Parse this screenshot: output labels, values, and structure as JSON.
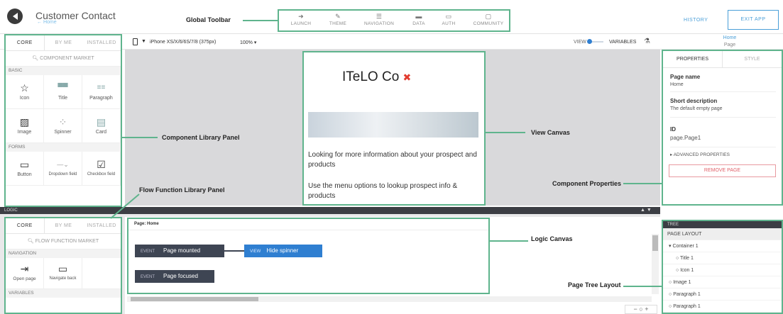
{
  "header": {
    "app_title": "Customer Contact",
    "app_sub": "← Home",
    "history_label": "HISTORY",
    "exit_label": "EXIT APP"
  },
  "toolbar": {
    "items": [
      {
        "label": "LAUNCH",
        "icon": "rocket-icon",
        "glyph": "➜"
      },
      {
        "label": "THEME",
        "icon": "brush-icon",
        "glyph": "✎"
      },
      {
        "label": "NAVIGATION",
        "icon": "list-icon",
        "glyph": "☰"
      },
      {
        "label": "DATA",
        "icon": "folder-icon",
        "glyph": "▬"
      },
      {
        "label": "AUTH",
        "icon": "document-icon",
        "glyph": "▭"
      },
      {
        "label": "COMMUNITY",
        "icon": "chat-icon",
        "glyph": "▢"
      }
    ]
  },
  "annotations": {
    "global_toolbar": "Global Toolbar",
    "component_library": "Component Library Panel",
    "view_canvas": "View Canvas",
    "flow_function": "Flow Function Library Panel",
    "component_properties": "Component Properties",
    "logic_canvas": "Logic Canvas",
    "page_tree": "Page Tree Layout"
  },
  "device_bar": {
    "device": "iPhone XS/X/6/6S/7/8 (375px)",
    "zoom": "100%",
    "view_label": "VIEW",
    "variables_label": "VARIABLES",
    "crumb_top": "Home",
    "crumb_bottom": "Page"
  },
  "component_panel": {
    "tabs": [
      "CORE",
      "BY ME",
      "INSTALLED"
    ],
    "search": "COMPONENT MARKET",
    "basic_label": "BASIC",
    "basic_items": [
      {
        "label": "Icon",
        "glyph": "☆"
      },
      {
        "label": "Title",
        "glyph": "▀▀"
      },
      {
        "label": "Paragraph",
        "glyph": "≡≡"
      },
      {
        "label": "Image",
        "glyph": "▨"
      },
      {
        "label": "Spinner",
        "glyph": "⁘"
      },
      {
        "label": "Card",
        "glyph": "▤"
      }
    ],
    "forms_label": "FORMS",
    "forms_items": [
      {
        "label": "Button",
        "glyph": "▭"
      },
      {
        "label": "Dropdown field",
        "glyph": "—⌄"
      },
      {
        "label": "Checkbox field",
        "glyph": "☑"
      }
    ]
  },
  "logic": {
    "bar_label": "LOGIC",
    "page_label": "Page: Home",
    "nodes": [
      {
        "kind": "EVENT",
        "text": "Page mounted"
      },
      {
        "kind": "VIEW",
        "text": "Hide spinner"
      },
      {
        "kind": "EVENT",
        "text": "Page focused"
      }
    ]
  },
  "function_panel": {
    "tabs": [
      "CORE",
      "BY ME",
      "INSTALLED"
    ],
    "search": "FLOW FUNCTION MARKET",
    "nav_label": "NAVIGATION",
    "items": [
      {
        "label": "Open page",
        "glyph": "⇥"
      },
      {
        "label": "Navigate back",
        "glyph": "▭"
      }
    ],
    "variables_label": "VARIABLES"
  },
  "phone": {
    "brand": "ITeLO Co",
    "text1": "Looking for more information about your prospect and products",
    "text2": "Use the menu options to lookup prospect info & products"
  },
  "properties": {
    "tabs": [
      "PROPERTIES",
      "STYLE"
    ],
    "page_name_label": "Page name",
    "page_name_value": "Home",
    "short_desc_label": "Short description",
    "short_desc_value": "The default empty page",
    "id_label": "ID",
    "id_value": "page.Page1",
    "advanced": "ADVANCED PROPERTIES",
    "remove": "REMOVE PAGE"
  },
  "tree": {
    "header": "TREE",
    "section": "PAGE LAYOUT",
    "rows": [
      "Container 1",
      "Title 1",
      "Icon 1",
      "Image 1",
      "Paragraph 1",
      "Paragraph 1"
    ]
  },
  "colors": {
    "accent_green": "#5fb48d",
    "primary_blue": "#2f7fd1",
    "dark_bar": "#3c3e44"
  }
}
